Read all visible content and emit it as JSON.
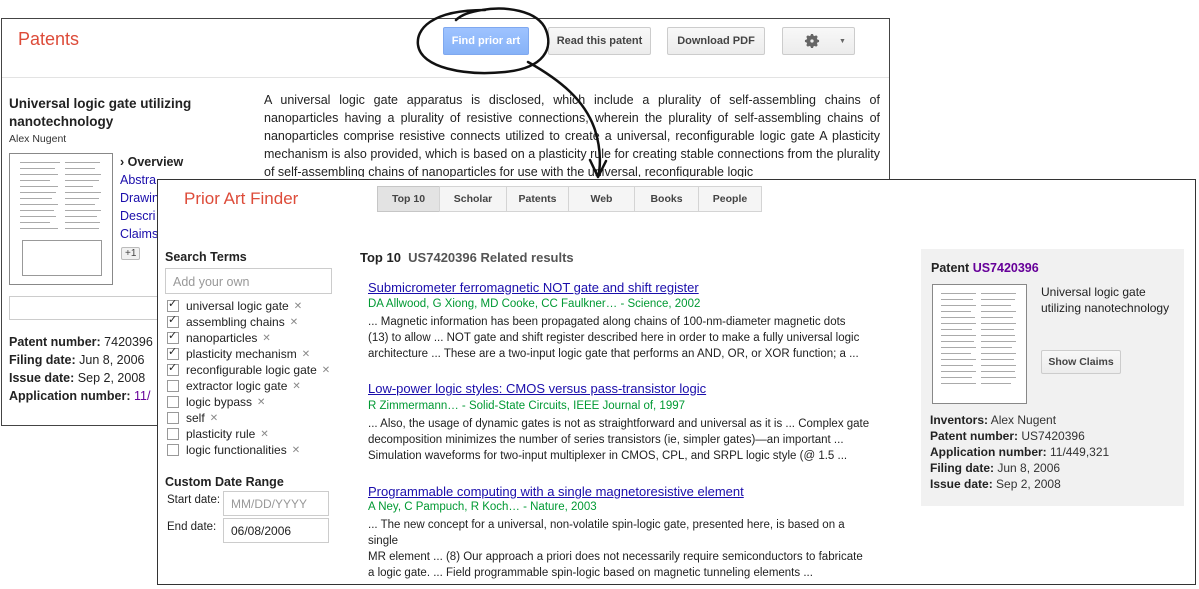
{
  "back": {
    "brand": "Patents",
    "buttons": {
      "find_prior_art": "Find prior art",
      "read_patent": "Read this patent",
      "download_pdf": "Download PDF"
    },
    "title": "Universal logic gate utilizing nanotechnology",
    "author": "Alex Nugent",
    "overview": "› Overview",
    "nav": [
      "Abstra",
      "Drawin",
      "Descri",
      "Claims"
    ],
    "plus_one": "+1",
    "abstract": "A universal logic gate apparatus is disclosed, which include a plurality of self-assembling chains of nanoparticles having a plurality of resistive connections, wherein the plurality of self-assembling chains of nanoparticles comprise resistive connects utilized to create a universal, reconfigurable logic gate A plasticity mechanism is also provided, which is based on a plasticity rule for creating stable connections from the plurality of self-assembling chains of nanoparticles for use with the universal, reconfigurable logic",
    "meta": [
      {
        "label": "Patent number:",
        "value": "7420396"
      },
      {
        "label": "Filing date:",
        "value": "Jun 8, 2006"
      },
      {
        "label": "Issue date:",
        "value": "Sep 2, 2008"
      },
      {
        "label": "Application number:",
        "value": "11/"
      }
    ]
  },
  "front": {
    "brand": "Prior Art Finder",
    "tabs": [
      "Top 10",
      "Scholar",
      "Patents",
      "Web",
      "Books",
      "People"
    ],
    "search_terms_heading": "Search Terms",
    "add_own_placeholder": "Add your own",
    "terms": [
      {
        "label": "universal logic gate",
        "checked": true
      },
      {
        "label": "assembling chains",
        "checked": true
      },
      {
        "label": "nanoparticles",
        "checked": true
      },
      {
        "label": "plasticity mechanism",
        "checked": true
      },
      {
        "label": "reconfigurable logic gate",
        "checked": true
      },
      {
        "label": "extractor logic gate",
        "checked": false
      },
      {
        "label": "logic bypass",
        "checked": false
      },
      {
        "label": "self",
        "checked": false
      },
      {
        "label": "plasticity rule",
        "checked": false
      },
      {
        "label": "logic functionalities",
        "checked": false
      }
    ],
    "custom_date_heading": "Custom Date Range",
    "start_label": "Start date:",
    "start_placeholder": "MM/DD/YYYY",
    "end_label": "End date:",
    "end_value": "06/08/2006",
    "results_heading": "Top 10",
    "results_sub": "US7420396 Related results",
    "results": [
      {
        "title": "Submicrometer ferromagnetic NOT gate and shift register",
        "authors": "DA Allwood, G Xiong, MD Cooke, CC Faulkner… - Science, 2002",
        "lines": [
          "... Magnetic information has been propagated along chains of 100-nm-diameter magnetic dots",
          "(13) to allow ... NOT gate and shift register described here in order to make a fully universal logic",
          "architecture ... These are a two-input logic gate that performs an AND, OR, or XOR function; a ..."
        ]
      },
      {
        "title": "Low-power logic styles: CMOS versus pass-transistor logic",
        "authors": "R Zimmermann… - Solid-State Circuits, IEEE Journal of, 1997",
        "lines": [
          "... Also, the usage of dynamic gates is not as straightforward and universal as it is ... Complex gate",
          "decomposition minimizes the number of series transistors (ie, simpler gates)—an important ...",
          "Simulation waveforms for two-input multiplexer in CMOS, CPL, and SRPL logic style (@ 1.5 ..."
        ]
      },
      {
        "title": "Programmable computing with a single magnetoresistive element",
        "authors": "A Ney, C Pampuch, R Koch… - Nature, 2003",
        "lines": [
          "... The new concept for a universal, non-volatile spin-logic gate, presented here, is based on a",
          "single",
          "MR element ... (8) Our approach a priori does not necessarily require semiconductors to fabricate",
          "a logic gate. ... Field programmable spin-logic based on magnetic tunneling elements ..."
        ]
      }
    ],
    "side": {
      "patent_label": "Patent",
      "patent_id": "US7420396",
      "title": "Universal logic gate utilizing nanotechnology",
      "show_claims": "Show Claims",
      "info": [
        {
          "label": "Inventors:",
          "value": "Alex Nugent"
        },
        {
          "label": "Patent number:",
          "value": "US7420396"
        },
        {
          "label": "Application number:",
          "value": "11/449,321"
        },
        {
          "label": "Filing date:",
          "value": "Jun 8, 2006"
        },
        {
          "label": "Issue date:",
          "value": "Sep 2, 2008"
        }
      ]
    }
  },
  "icons": {
    "settings": "gear-icon",
    "dropdown": "chevron-down-icon",
    "check": "checkmark-icon",
    "remove": "close-icon"
  },
  "colors": {
    "brand": "#dd4b39",
    "link": "#1a0dab",
    "author_green": "#009933",
    "primary_button": "#87b2f7",
    "visited": "#660099"
  }
}
